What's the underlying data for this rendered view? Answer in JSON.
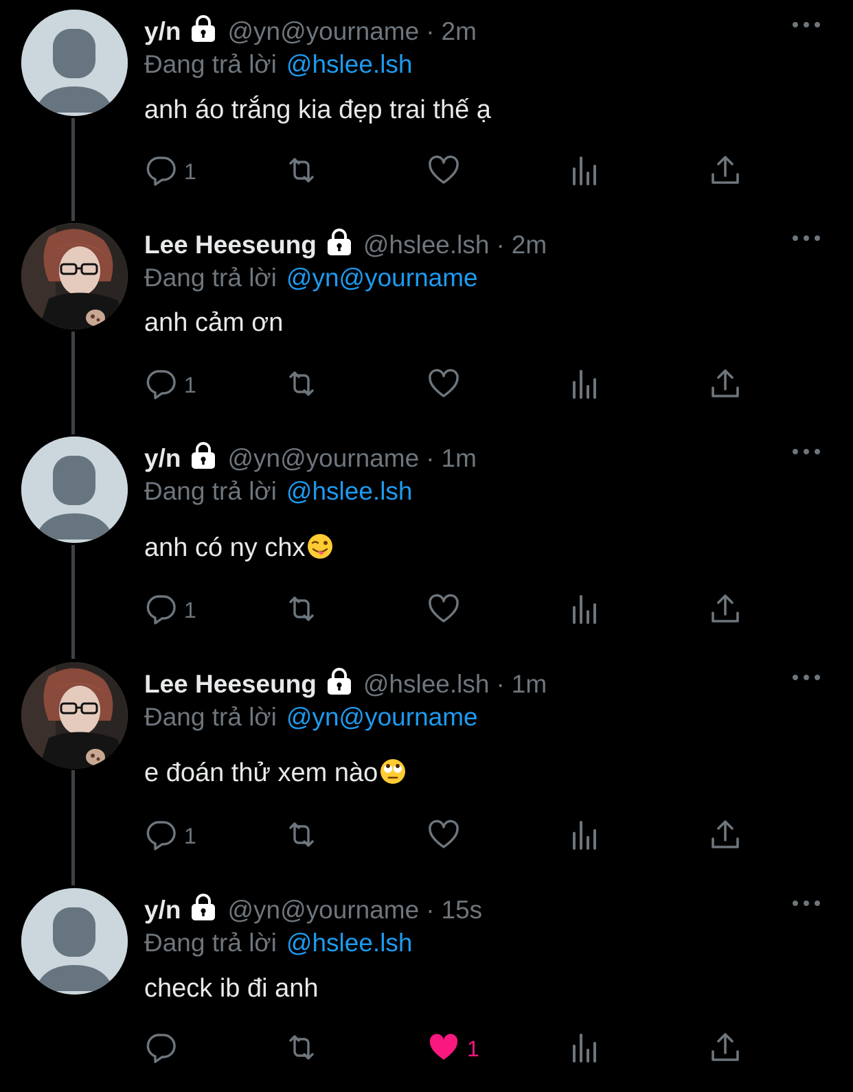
{
  "replying_label": "Đang trả lời",
  "colors": {
    "background": "#000000",
    "muted": "#6e767d",
    "link": "#1d9bf0",
    "like": "#f91880"
  },
  "icons": {
    "reply": "reply-icon",
    "retweet": "retweet-icon",
    "like": "heart-icon",
    "views": "analytics-icon",
    "share": "share-icon",
    "lock": "lock-icon",
    "more": "more-icon"
  },
  "tweets": [
    {
      "name": "y/n",
      "handle": "@yn@yourname",
      "time": "2m",
      "replying_to": "@hslee.lsh",
      "text": "anh áo trắng kia đẹp trai thế ạ",
      "emoji": "",
      "reply_count": "1",
      "like_count": "",
      "liked": false,
      "avatar": "default"
    },
    {
      "name": "Lee Heeseung",
      "handle": "@hslee.lsh",
      "time": "2m",
      "replying_to": "@yn@yourname",
      "text": "anh cảm ơn",
      "emoji": "",
      "reply_count": "1",
      "like_count": "",
      "liked": false,
      "avatar": "photo"
    },
    {
      "name": "y/n",
      "handle": "@yn@yourname",
      "time": "1m",
      "replying_to": "@hslee.lsh",
      "text": "anh có ny chx",
      "emoji": "winking-face-with-tongue",
      "reply_count": "1",
      "like_count": "",
      "liked": false,
      "avatar": "default"
    },
    {
      "name": "Lee Heeseung",
      "handle": "@hslee.lsh",
      "time": "1m",
      "replying_to": "@yn@yourname",
      "text": "e đoán thử xem nào",
      "emoji": "face-with-rolling-eyes",
      "reply_count": "1",
      "like_count": "",
      "liked": false,
      "avatar": "photo"
    },
    {
      "name": "y/n",
      "handle": "@yn@yourname",
      "time": "15s",
      "replying_to": "@hslee.lsh",
      "text": "check ib đi anh",
      "emoji": "",
      "reply_count": "",
      "like_count": "1",
      "liked": true,
      "avatar": "default"
    }
  ]
}
